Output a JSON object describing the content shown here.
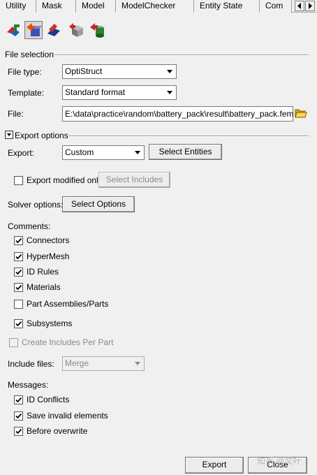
{
  "tabs": [
    {
      "label": "Utility"
    },
    {
      "label": "Mask"
    },
    {
      "label": "Model"
    },
    {
      "label": "ModelChecker"
    },
    {
      "label": "Entity State"
    },
    {
      "label": "Com"
    }
  ],
  "tab_scroll": {
    "left_icon": "arrow-left-icon",
    "right_icon": "arrow-right-icon"
  },
  "toolbar": {
    "icons": [
      "import-icon",
      "export-icon",
      "import-solver-icon",
      "cube-icon",
      "cylinder-export-icon"
    ],
    "selected_index": 1
  },
  "file_selection": {
    "title": "File selection",
    "file_type_label": "File type:",
    "file_type_value": "OptiStruct",
    "template_label": "Template:",
    "template_value": "Standard format",
    "file_label": "File:",
    "file_value": "E:\\data\\practice\\random\\battery_pack\\result\\battery_pack.fem"
  },
  "export_options": {
    "title": "Export options",
    "export_label": "Export:",
    "export_value": "Custom",
    "select_entities": "Select Entities",
    "export_modified_only": {
      "label": "Export modified only",
      "checked": false
    },
    "select_includes": "Select Includes",
    "solver_options_label": "Solver options:",
    "select_options": "Select Options"
  },
  "comments": {
    "title": "Comments:",
    "items": [
      {
        "label": "Connectors",
        "checked": true
      },
      {
        "label": "HyperMesh",
        "checked": true
      },
      {
        "label": "ID Rules",
        "checked": true
      },
      {
        "label": "Materials",
        "checked": true
      },
      {
        "label": "Part Assemblies/Parts",
        "checked": false
      },
      {
        "label": "Subsystems",
        "checked": true
      }
    ]
  },
  "create_includes_per_part": {
    "label": "Create Includes Per Part",
    "checked": false
  },
  "include_files": {
    "label": "Include files:",
    "value": "Merge"
  },
  "messages": {
    "title": "Messages:",
    "items": [
      {
        "label": "ID Conflicts",
        "checked": true
      },
      {
        "label": "Save invalid elements",
        "checked": true
      },
      {
        "label": "Before overwrite",
        "checked": true
      }
    ]
  },
  "footer": {
    "export_button": "Export",
    "close_button": "Close"
  },
  "watermark": "知乎 @文叶"
}
